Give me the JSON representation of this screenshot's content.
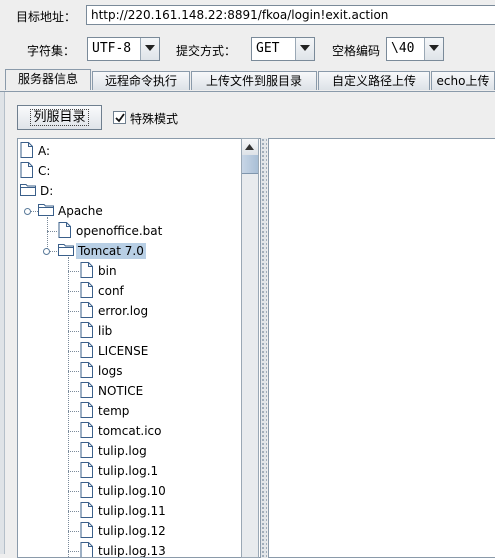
{
  "target": {
    "label": "目标地址：",
    "url": "http://220.161.148.22:8891/fkoa/login!exit.action"
  },
  "options": {
    "charset_label": "字符集：",
    "charset_value": "UTF-8",
    "method_label": "提交方式：",
    "method_value": "GET",
    "space_label": "空格编码",
    "space_value": "\\40"
  },
  "tabs": [
    "服务器信息",
    "远程命令执行",
    "上传文件到服目录",
    "自定义路径上传",
    "echo上传"
  ],
  "toolbar": {
    "list_button": "列服目录",
    "special_mode": "特殊模式",
    "special_mode_checked": true
  },
  "tree": [
    {
      "label": "A:",
      "type": "file",
      "level": 0
    },
    {
      "label": "C:",
      "type": "file",
      "level": 0
    },
    {
      "label": "D:",
      "type": "folder",
      "level": 0
    },
    {
      "label": "Apache",
      "type": "folder",
      "level": 1
    },
    {
      "label": "openoffice.bat",
      "type": "file",
      "level": 2
    },
    {
      "label": "Tomcat 7.0",
      "type": "folder",
      "level": 2,
      "selected": true
    },
    {
      "label": "bin",
      "type": "file",
      "level": 3
    },
    {
      "label": "conf",
      "type": "file",
      "level": 3
    },
    {
      "label": "error.log",
      "type": "file",
      "level": 3
    },
    {
      "label": "lib",
      "type": "file",
      "level": 3
    },
    {
      "label": "LICENSE",
      "type": "file",
      "level": 3
    },
    {
      "label": "logs",
      "type": "file",
      "level": 3
    },
    {
      "label": "NOTICE",
      "type": "file",
      "level": 3
    },
    {
      "label": "temp",
      "type": "file",
      "level": 3
    },
    {
      "label": "tomcat.ico",
      "type": "file",
      "level": 3
    },
    {
      "label": "tulip.log",
      "type": "file",
      "level": 3
    },
    {
      "label": "tulip.log.1",
      "type": "file",
      "level": 3
    },
    {
      "label": "tulip.log.10",
      "type": "file",
      "level": 3
    },
    {
      "label": "tulip.log.11",
      "type": "file",
      "level": 3
    },
    {
      "label": "tulip.log.12",
      "type": "file",
      "level": 3
    },
    {
      "label": "tulip.log.13",
      "type": "file",
      "level": 3
    }
  ]
}
